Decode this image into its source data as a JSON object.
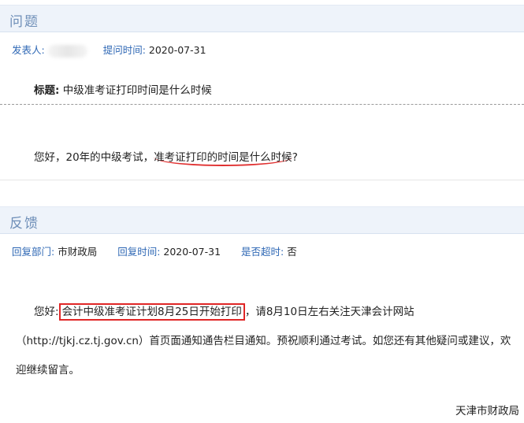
{
  "question": {
    "section_title": "问题",
    "poster_label": "发表人:",
    "time_label": "提问时间:",
    "time_value": "2020-07-31",
    "title_label": "标题:",
    "title_value": "中级准考证打印时间是什么时候",
    "body_prefix": "您好，20年的中级考试，",
    "body_highlight": "准考证打印的时间是什么时候",
    "body_suffix": "?"
  },
  "feedback": {
    "section_title": "反馈",
    "dept_label": "回复部门:",
    "dept_value": "市财政局",
    "time_label": "回复时间:",
    "time_value": "2020-07-31",
    "overdue_label": "是否超时:",
    "overdue_value": "否",
    "answer_prefix": "您好:",
    "answer_highlight": "会计中级准考证计划8月25日开始打印",
    "answer_rest": "，请8月10日左右关注天津会计网站（http://tjkj.cz.tj.gov.cn）首页面通知通告栏目通知。预祝顺利通过考试。如您还有其他疑问或建议，欢迎继续留言。",
    "signature": "天津市财政局"
  },
  "colors": {
    "label": "#2f68b5",
    "highlight": "#e02626",
    "header_bg": "#eef3fa"
  }
}
